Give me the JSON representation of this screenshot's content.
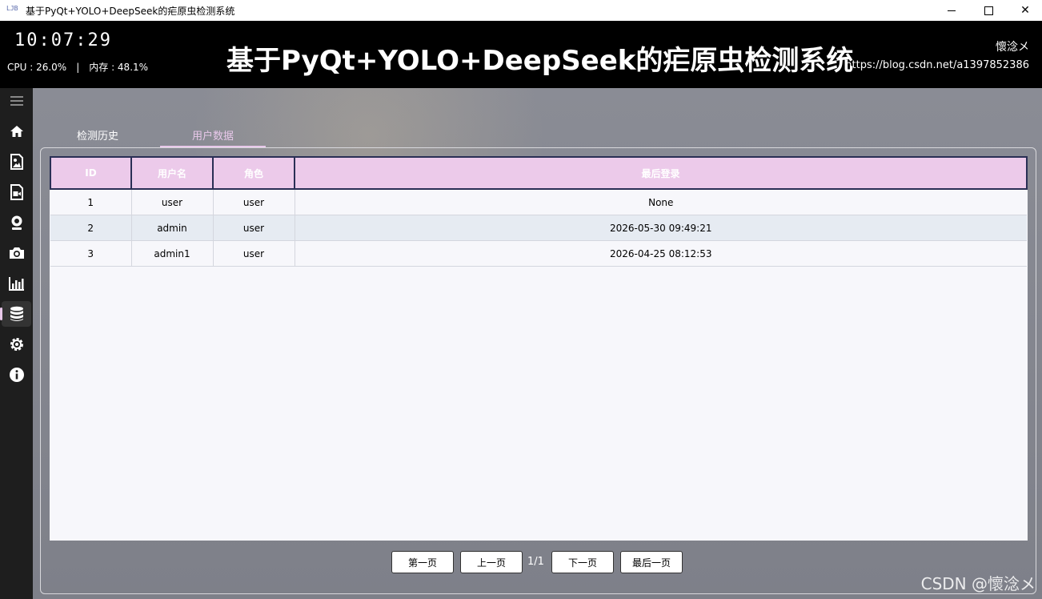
{
  "window": {
    "app_icon": "LJB",
    "title": "基于PyQt+YOLO+DeepSeek的疟原虫检测系统",
    "minimize_icon": "minimize-icon",
    "maximize_icon": "maximize-icon",
    "close_symbol": "✕"
  },
  "header": {
    "clock": "10:07:29",
    "cpu": "CPU : 26.0%",
    "separator": "|",
    "memory": "内存 : 48.1%",
    "title": "基于PyQt+YOLO+DeepSeek的疟原虫检测系统",
    "author": "懷淰メ",
    "blog": "https://blog.csdn.net/a1397852386"
  },
  "sidebar": {
    "items": [
      {
        "icon": "menu-icon"
      },
      {
        "icon": "home-icon"
      },
      {
        "icon": "image-detect-icon"
      },
      {
        "icon": "video-detect-icon"
      },
      {
        "icon": "webcam-icon"
      },
      {
        "icon": "camera-icon"
      },
      {
        "icon": "chart-icon"
      },
      {
        "icon": "database-icon",
        "active": true
      },
      {
        "icon": "settings-icon"
      },
      {
        "icon": "info-icon"
      }
    ]
  },
  "tabs": [
    {
      "label": "检测历史"
    },
    {
      "label": "用户数据",
      "active": true
    }
  ],
  "table": {
    "columns": [
      "ID",
      "用户名",
      "角色",
      "最后登录"
    ],
    "rows": [
      [
        "1",
        "user",
        "user",
        "None"
      ],
      [
        "2",
        "admin",
        "user",
        "2026-05-30 09:49:21"
      ],
      [
        "3",
        "admin1",
        "user",
        "2026-04-25 08:12:53"
      ]
    ]
  },
  "pager": {
    "first": "第一页",
    "prev": "上一页",
    "info": "1/1",
    "next": "下一页",
    "last": "最后一页"
  },
  "watermark": "CSDN @懷淰メ",
  "colors": {
    "accent": "#e8c8ea",
    "header_bg": "#000000",
    "sidebar_bg": "#1e1e1e",
    "table_header_bg": "#eccaea",
    "table_header_border": "#2a2f55"
  }
}
